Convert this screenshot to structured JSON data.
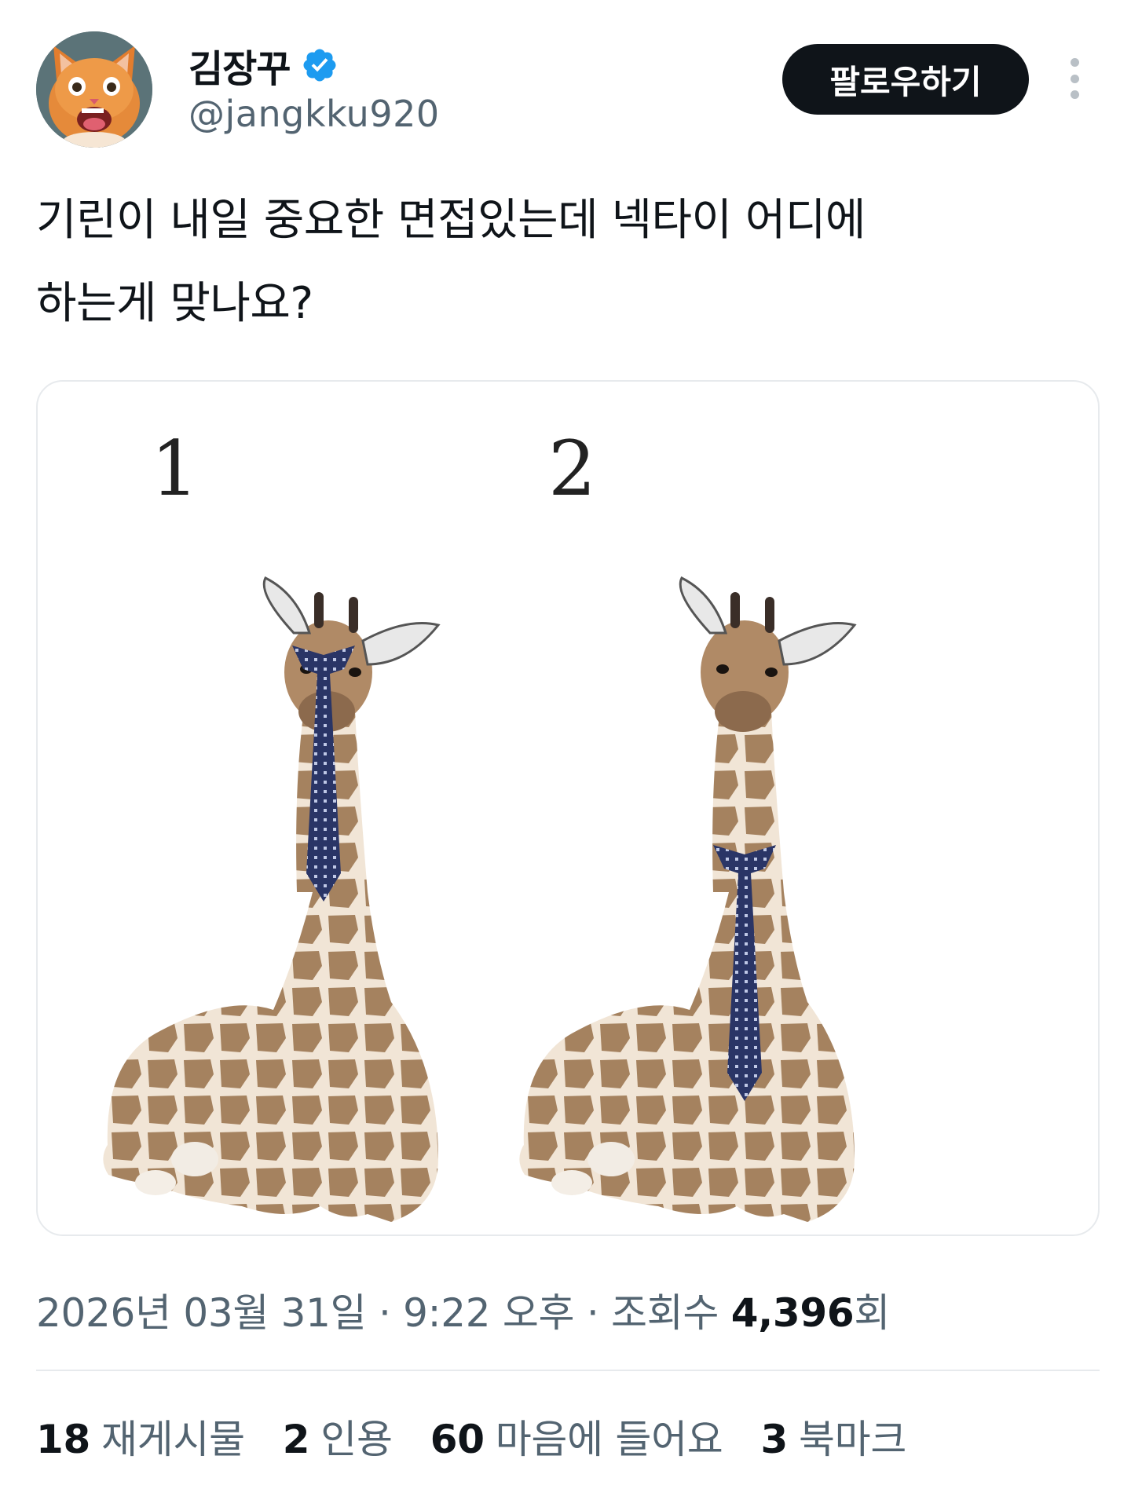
{
  "author": {
    "display_name": "김장꾸",
    "handle": "@jangkku920",
    "verified": true
  },
  "header": {
    "follow_label": "팔로우하기"
  },
  "tweet": {
    "text_lines": [
      "기린이 내일 중요한 면접있는데 넥타이 어디에",
      "하는게 맞나요?"
    ]
  },
  "media": {
    "panels": [
      {
        "number": "1",
        "tie_position": "neck-top"
      },
      {
        "number": "2",
        "tie_position": "neck-base"
      }
    ]
  },
  "meta": {
    "date": "2026년 03월 31일",
    "time": "9:22 오후",
    "separator": "·",
    "views_label": "조회수",
    "views_count": "4,396",
    "views_suffix": "회"
  },
  "stats": [
    {
      "count": "18",
      "label": "재게시물"
    },
    {
      "count": "2",
      "label": "인용"
    },
    {
      "count": "60",
      "label": "마음에 들어요"
    },
    {
      "count": "3",
      "label": "북마크"
    }
  ],
  "colors": {
    "text": "#0f1419",
    "secondary": "#536471",
    "verified_blue": "#1d9bf0",
    "border": "#e7eaed",
    "tie_navy": "#2a3566"
  }
}
